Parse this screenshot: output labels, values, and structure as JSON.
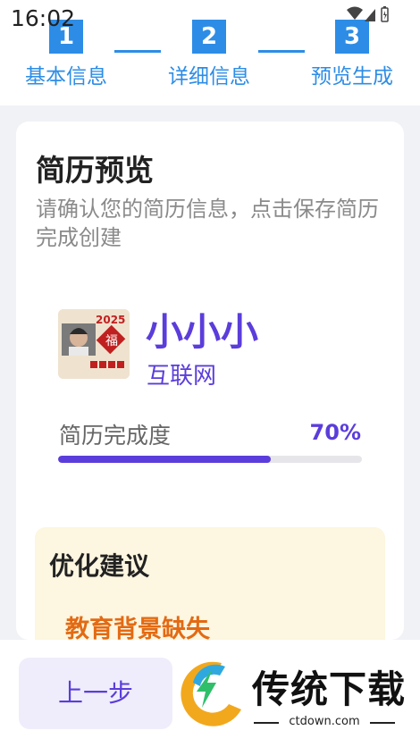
{
  "status_bar": {
    "time": "16:02"
  },
  "stepper": {
    "steps": [
      {
        "number": "1",
        "label": "基本信息"
      },
      {
        "number": "2",
        "label": "详细信息"
      },
      {
        "number": "3",
        "label": "预览生成"
      }
    ]
  },
  "card": {
    "title": "简历预览",
    "subtitle": "请确认您的简历信息，点击保存简历完成创建",
    "profile": {
      "name": "小小小",
      "industry": "互联网"
    },
    "progress": {
      "label": "简历完成度",
      "value_text": "70%",
      "fraction": 0.7
    },
    "suggestions": {
      "title": "优化建议",
      "items": [
        "教育背景缺失"
      ]
    }
  },
  "bottom": {
    "prev_label": "上一步"
  },
  "watermark": {
    "title": "传统下载",
    "url": "ctdown.com"
  },
  "colors": {
    "step_blue": "#2d8de6",
    "accent_purple": "#5b3ddb",
    "warning_orange": "#e36a13",
    "suggest_bg": "#fdf6e0"
  }
}
